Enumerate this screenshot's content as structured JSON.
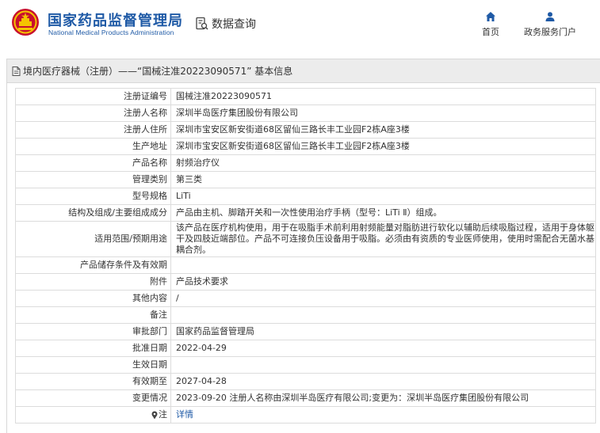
{
  "header": {
    "brand_cn": "国家药品监督管理局",
    "brand_en": "National Medical Products Administration",
    "search_label": "数据查询",
    "nav": [
      {
        "label": "首页",
        "icon": "home-icon"
      },
      {
        "label": "政务服务门户",
        "icon": "user-icon"
      }
    ]
  },
  "section": {
    "title": "境内医疗器械（注册）——“国械注准20223090571” 基本信息",
    "title_icon": "document-icon"
  },
  "details": [
    {
      "label": "注册证编号",
      "value": "国械注准20223090571"
    },
    {
      "label": "注册人名称",
      "value": "深圳半岛医疗集团股份有限公司"
    },
    {
      "label": "注册人住所",
      "value": "深圳市宝安区新安街道68区留仙三路长丰工业园F2栋A座3楼"
    },
    {
      "label": "生产地址",
      "value": "深圳市宝安区新安街道68区留仙三路长丰工业园F2栋A座3楼"
    },
    {
      "label": "产品名称",
      "value": "射频治疗仪"
    },
    {
      "label": "管理类别",
      "value": "第三类"
    },
    {
      "label": "型号规格",
      "value": "LiTi"
    },
    {
      "label": "结构及组成/主要组成成分",
      "value": "产品由主机、脚踏开关和一次性使用治疗手柄（型号：LiTi Ⅱ）组成。"
    },
    {
      "label": "适用范围/预期用途",
      "value": "该产品在医疗机构使用，用于在吸脂手术前利用射频能量对脂肪进行软化以辅助后续吸脂过程，适用于身体躯干及四肢近端部位。产品不可连接负压设备用于吸脂。必须由有资质的专业医师使用，使用时需配合无菌水基耦合剂。"
    },
    {
      "label": "产品储存条件及有效期",
      "value": ""
    },
    {
      "label": "附件",
      "value": "产品技术要求"
    },
    {
      "label": "其他内容",
      "value": "/"
    },
    {
      "label": "备注",
      "value": ""
    },
    {
      "label": "审批部门",
      "value": "国家药品监督管理局"
    },
    {
      "label": "批准日期",
      "value": "2022-04-29"
    },
    {
      "label": "生效日期",
      "value": ""
    },
    {
      "label": "有效期至",
      "value": "2027-04-28"
    },
    {
      "label": "变更情况",
      "value": "2023-09-20 注册人名称由深圳半岛医疗有限公司;变更为：深圳半岛医疗集团股份有限公司"
    },
    {
      "label": "注",
      "value": "详情",
      "icon": "pin-icon"
    }
  ]
}
